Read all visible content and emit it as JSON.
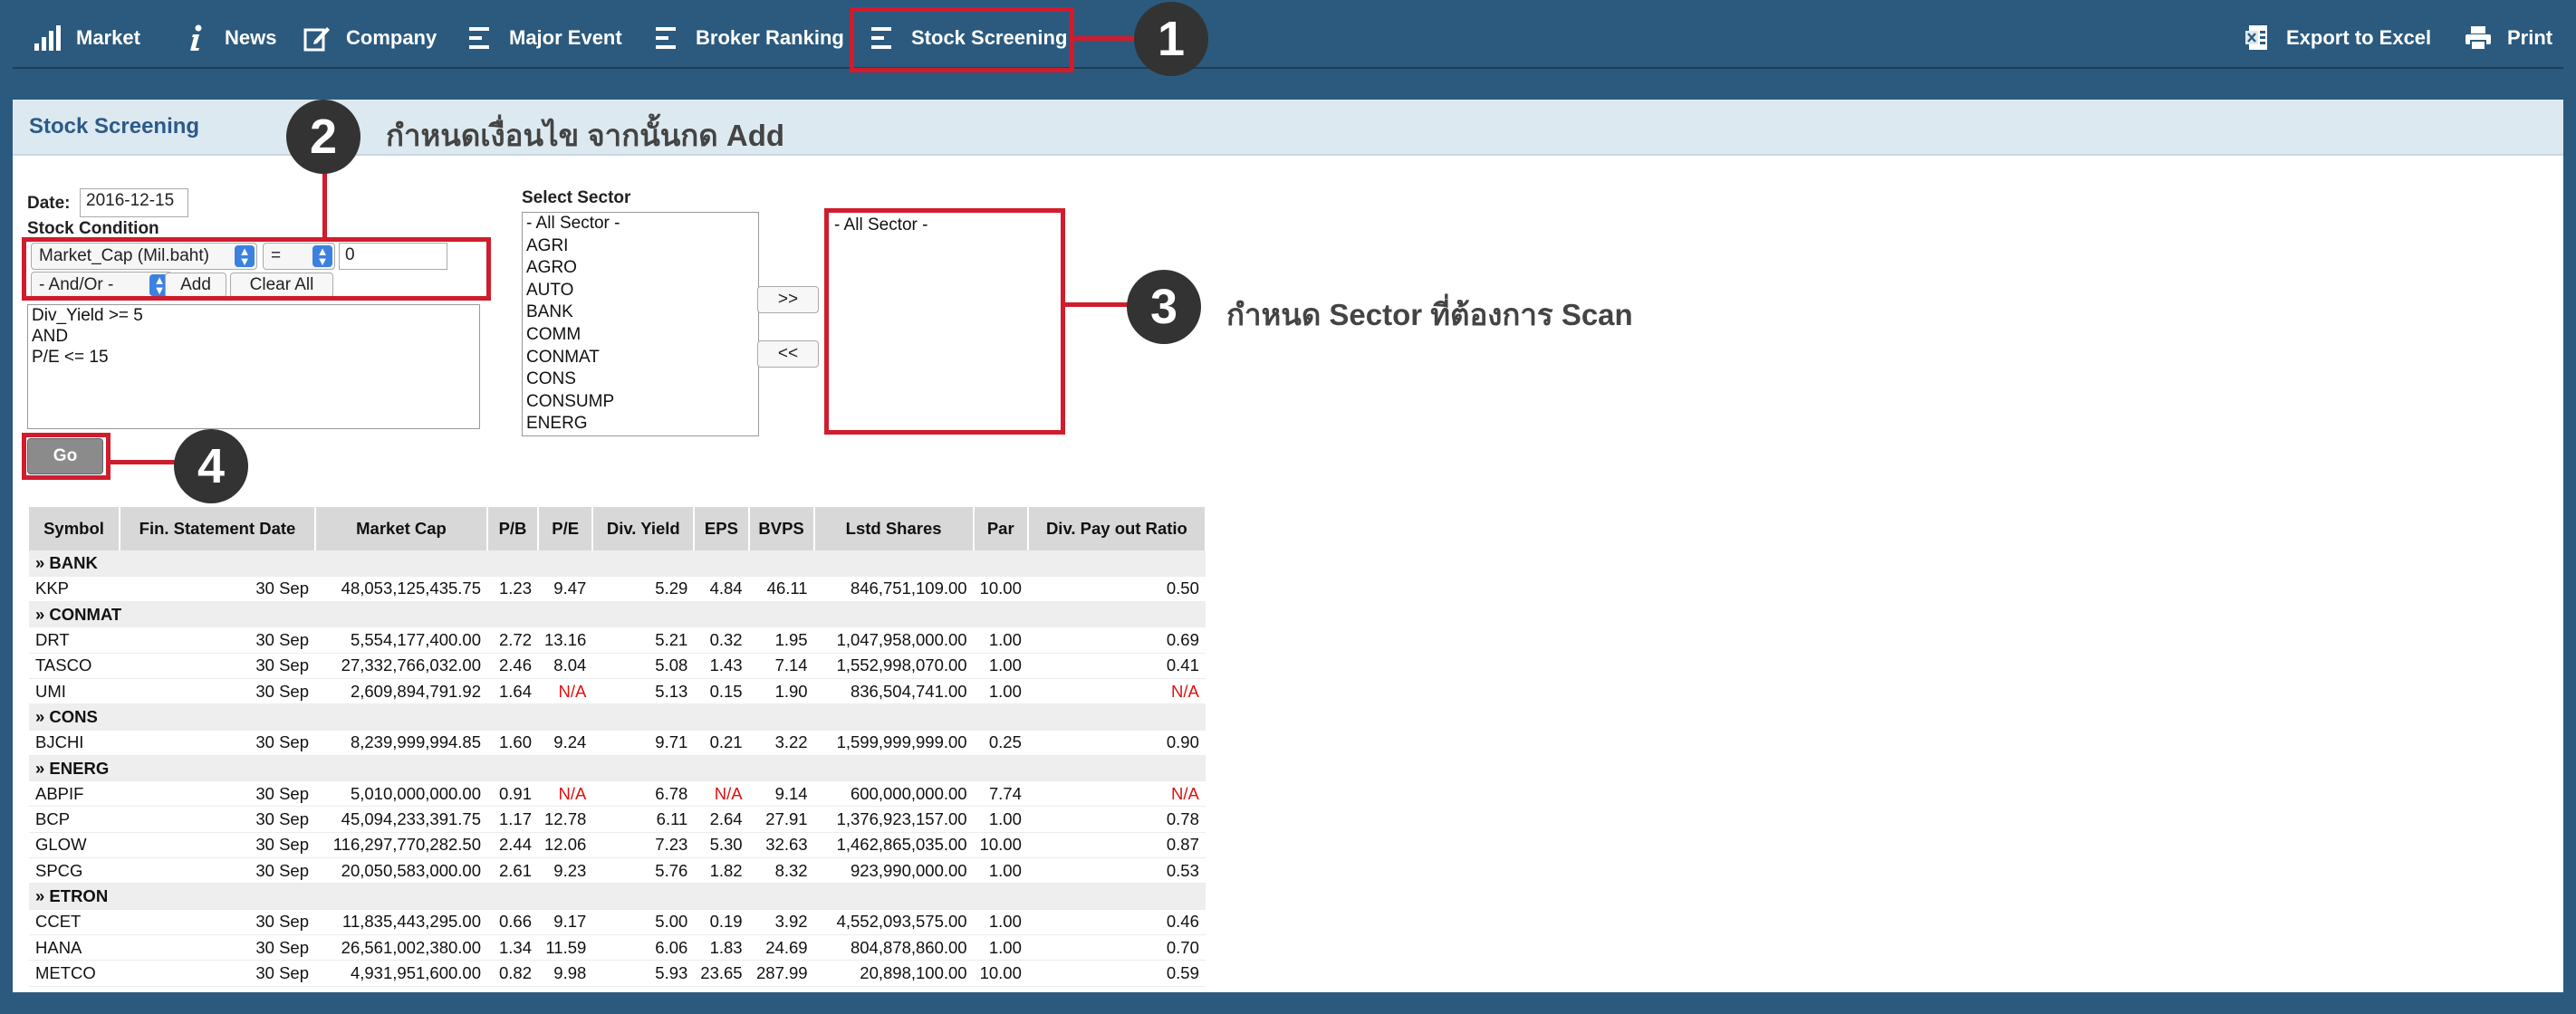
{
  "nav": {
    "items": [
      {
        "label": "Market",
        "icon": "bar-chart-icon"
      },
      {
        "label": "News",
        "icon": "info-icon"
      },
      {
        "label": "Company",
        "icon": "edit-icon"
      },
      {
        "label": "Major Event",
        "icon": "list-icon"
      },
      {
        "label": "Broker Ranking",
        "icon": "list-icon"
      },
      {
        "label": "Stock Screening",
        "icon": "list-icon"
      }
    ],
    "export_label": "Export to Excel",
    "print_label": "Print"
  },
  "callouts": [
    "1",
    "2",
    "3",
    "4"
  ],
  "annotations": {
    "step2": "กำหนดเงื่อนไข จากนั้นกด Add",
    "step3": "กำหนด Sector ที่ต้องการ Scan"
  },
  "panel": {
    "title": "Stock Screening",
    "date_label": "Date:",
    "date_value": "2016-12-15",
    "condition_label": "Stock Condition",
    "field_select": "Market_Cap (Mil.baht)",
    "operator_select": "=",
    "value_input": "0",
    "andor_select": "- And/Or -",
    "add_label": "Add",
    "clear_label": "Clear All",
    "conditions": [
      "Div_Yield >= 5",
      "AND",
      "P/E <= 15"
    ],
    "sector_label": "Select Sector",
    "sectors": [
      "- All Sector -",
      "AGRI",
      "AGRO",
      "AUTO",
      "BANK",
      "COMM",
      "CONMAT",
      "CONS",
      "CONSUMP",
      "ENERG"
    ],
    "add_sector_label": ">>",
    "remove_sector_label": "<<",
    "selected_sectors": [
      "- All Sector -"
    ],
    "go_label": "Go"
  },
  "table": {
    "columns": [
      "Symbol",
      "Fin. Statement Date",
      "Market Cap",
      "P/B",
      "P/E",
      "Div. Yield",
      "EPS",
      "BVPS",
      "Lstd Shares",
      "Par",
      "Div. Pay out Ratio"
    ],
    "groups": [
      {
        "name": "» BANK",
        "rows": [
          [
            "KKP",
            "30 Sep",
            "48,053,125,435.75",
            "1.23",
            "9.47",
            "5.29",
            "4.84",
            "46.11",
            "846,751,109.00",
            "10.00",
            "0.50"
          ]
        ]
      },
      {
        "name": "» CONMAT",
        "rows": [
          [
            "DRT",
            "30 Sep",
            "5,554,177,400.00",
            "2.72",
            "13.16",
            "5.21",
            "0.32",
            "1.95",
            "1,047,958,000.00",
            "1.00",
            "0.69"
          ],
          [
            "TASCO",
            "30 Sep",
            "27,332,766,032.00",
            "2.46",
            "8.04",
            "5.08",
            "1.43",
            "7.14",
            "1,552,998,070.00",
            "1.00",
            "0.41"
          ],
          [
            "UMI",
            "30 Sep",
            "2,609,894,791.92",
            "1.64",
            "N/A",
            "5.13",
            "0.15",
            "1.90",
            "836,504,741.00",
            "1.00",
            "N/A"
          ]
        ]
      },
      {
        "name": "» CONS",
        "rows": [
          [
            "BJCHI",
            "30 Sep",
            "8,239,999,994.85",
            "1.60",
            "9.24",
            "9.71",
            "0.21",
            "3.22",
            "1,599,999,999.00",
            "0.25",
            "0.90"
          ]
        ]
      },
      {
        "name": "» ENERG",
        "rows": [
          [
            "ABPIF",
            "30 Sep",
            "5,010,000,000.00",
            "0.91",
            "N/A",
            "6.78",
            "N/A",
            "9.14",
            "600,000,000.00",
            "7.74",
            "N/A"
          ],
          [
            "BCP",
            "30 Sep",
            "45,094,233,391.75",
            "1.17",
            "12.78",
            "6.11",
            "2.64",
            "27.91",
            "1,376,923,157.00",
            "1.00",
            "0.78"
          ],
          [
            "GLOW",
            "30 Sep",
            "116,297,770,282.50",
            "2.44",
            "12.06",
            "7.23",
            "5.30",
            "32.63",
            "1,462,865,035.00",
            "10.00",
            "0.87"
          ],
          [
            "SPCG",
            "30 Sep",
            "20,050,583,000.00",
            "2.61",
            "9.23",
            "5.76",
            "1.82",
            "8.32",
            "923,990,000.00",
            "1.00",
            "0.53"
          ]
        ]
      },
      {
        "name": "» ETRON",
        "rows": [
          [
            "CCET",
            "30 Sep",
            "11,835,443,295.00",
            "0.66",
            "9.17",
            "5.00",
            "0.19",
            "3.92",
            "4,552,093,575.00",
            "1.00",
            "0.46"
          ],
          [
            "HANA",
            "30 Sep",
            "26,561,002,380.00",
            "1.34",
            "11.59",
            "6.06",
            "1.83",
            "24.69",
            "804,878,860.00",
            "1.00",
            "0.70"
          ],
          [
            "METCO",
            "30 Sep",
            "4,931,951,600.00",
            "0.82",
            "9.98",
            "5.93",
            "23.65",
            "287.99",
            "20,898,100.00",
            "10.00",
            "0.59"
          ]
        ]
      }
    ]
  },
  "colors": {
    "nav_bg": "#2b5a7e",
    "highlight": "#d01c2c",
    "title_blue": "#2c5a8a",
    "na_red": "#e01010"
  }
}
